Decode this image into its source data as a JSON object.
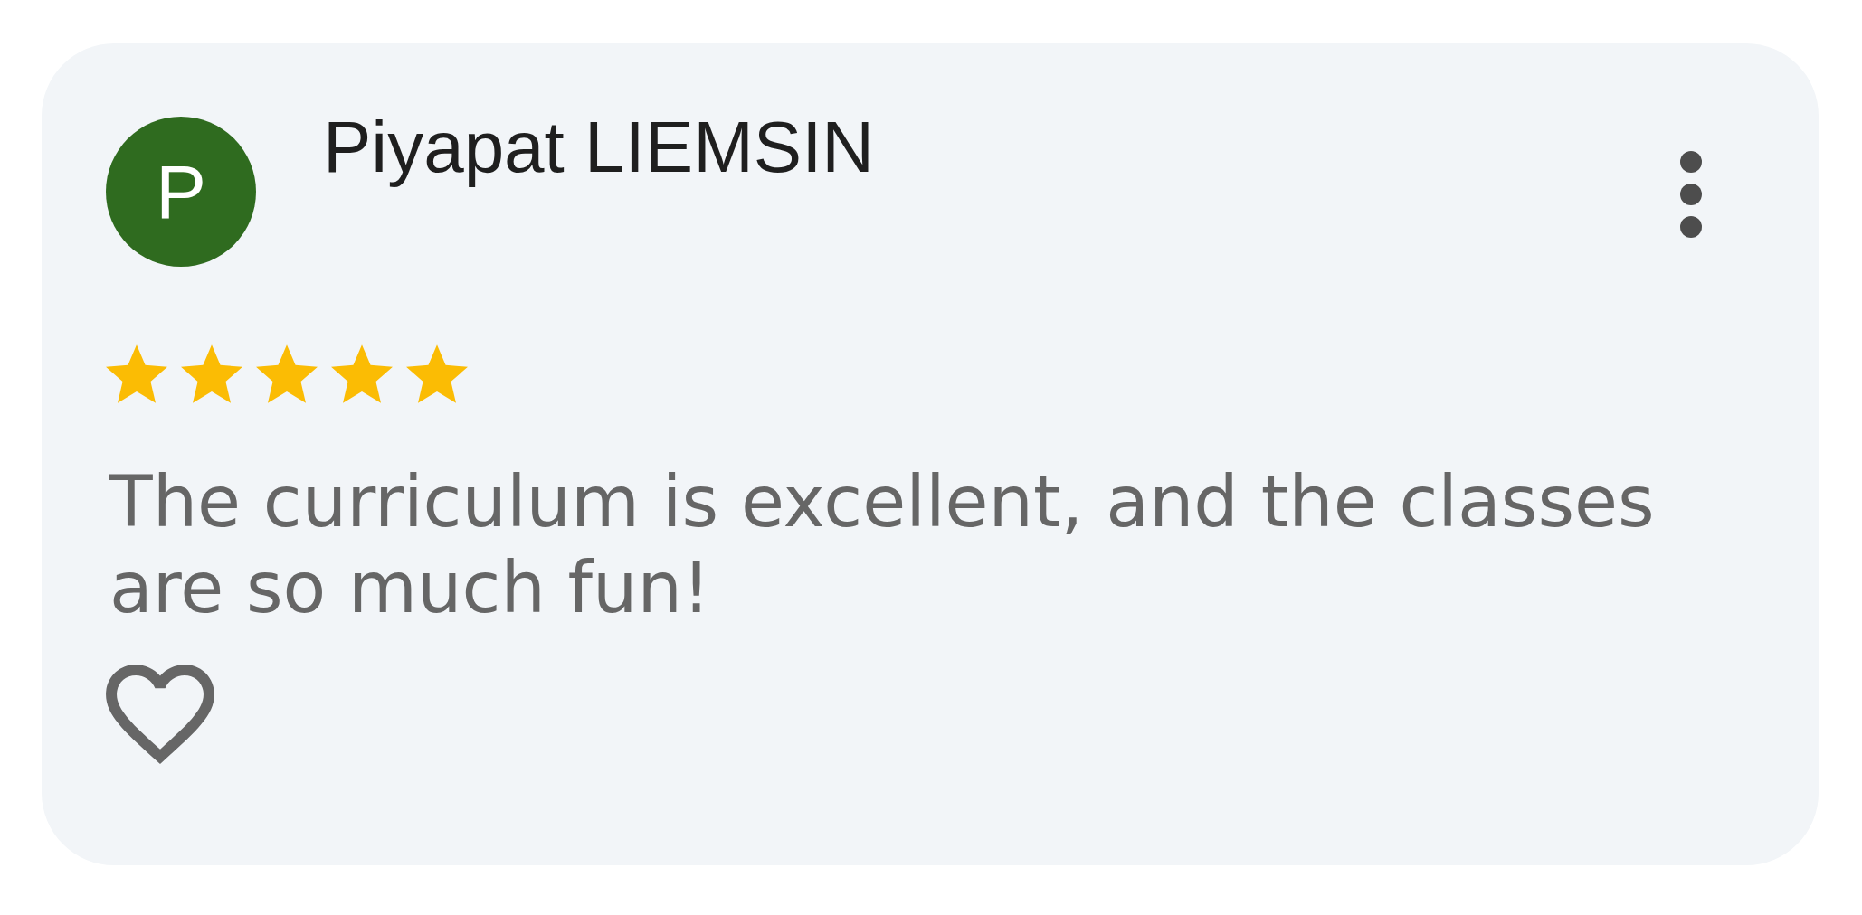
{
  "review": {
    "author": {
      "initial": "P",
      "name": "Piyapat LIEMSIN"
    },
    "stars": 5,
    "text": "The curriculum is excellent, and the classes are so much fun!",
    "liked": false
  }
}
